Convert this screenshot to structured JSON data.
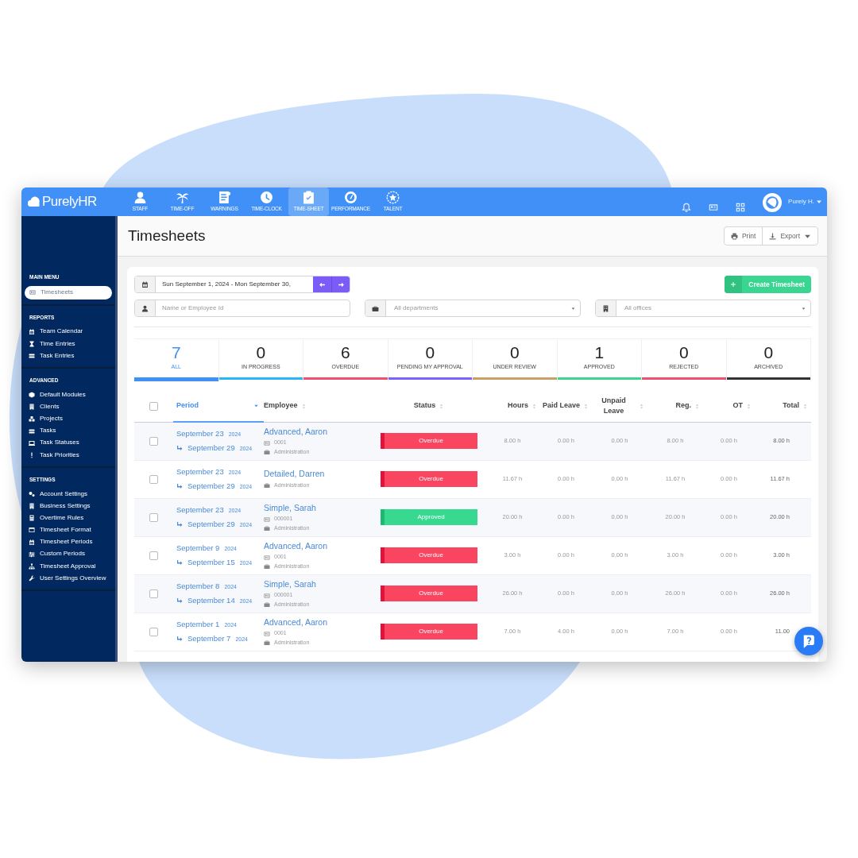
{
  "topbar": {
    "logo": "PurelyHR",
    "modules": [
      {
        "label": "STAFF",
        "selected": false
      },
      {
        "label": "TIME-OFF",
        "selected": false
      },
      {
        "label": "WARNINGS",
        "selected": false
      },
      {
        "label": "TIME-CLOCK",
        "selected": false
      },
      {
        "label": "TIME-SHEET",
        "selected": true
      },
      {
        "label": "PERFORMANCE",
        "selected": false
      },
      {
        "label": "TALENT",
        "selected": false
      }
    ],
    "user": "Purely H."
  },
  "sidebar": {
    "sections": [
      {
        "title": "MAIN MENU",
        "items": [
          {
            "label": "Timesheets",
            "selected": true
          }
        ]
      },
      {
        "title": "REPORTS",
        "items": [
          {
            "label": "Team Calendar",
            "selected": false
          },
          {
            "label": "Time Entries",
            "selected": false
          },
          {
            "label": "Task Entries",
            "selected": false
          }
        ]
      },
      {
        "title": "ADVANCED",
        "items": [
          {
            "label": "Default Modules",
            "selected": false
          },
          {
            "label": "Clients",
            "selected": false
          },
          {
            "label": "Projects",
            "selected": false
          },
          {
            "label": "Tasks",
            "selected": false
          },
          {
            "label": "Task Statuses",
            "selected": false
          },
          {
            "label": "Task Priorities",
            "selected": false
          }
        ]
      },
      {
        "title": "SETTINGS",
        "items": [
          {
            "label": "Account Settings",
            "selected": false
          },
          {
            "label": "Business Settings",
            "selected": false
          },
          {
            "label": "Overtime Rules",
            "selected": false
          },
          {
            "label": "Timesheet Format",
            "selected": false
          },
          {
            "label": "Timesheet Periods",
            "selected": false
          },
          {
            "label": "Custom Periods",
            "selected": false
          },
          {
            "label": "Timesheet Approval",
            "selected": false
          },
          {
            "label": "User Settings Overview",
            "selected": false
          }
        ]
      }
    ]
  },
  "page": {
    "title": "Timesheets",
    "actions": [
      "Print",
      "Export"
    ]
  },
  "filters": {
    "date_range": "Sun September 1, 2024 - Mon September 30,",
    "create_button": "Create Timesheet",
    "employee": {
      "placeholder": "Name or Employee Id"
    },
    "department": {
      "placeholder": "All departments"
    },
    "office": {
      "placeholder": "All offices"
    }
  },
  "status_tabs": [
    {
      "count": "7",
      "label": "ALL",
      "selected": true,
      "color": "#4190f7"
    },
    {
      "count": "0",
      "label": "IN PROGRESS",
      "selected": false,
      "color": "#29b6f6"
    },
    {
      "count": "6",
      "label": "OVERDUE",
      "selected": false,
      "color": "#f0506e"
    },
    {
      "count": "0",
      "label": "PENDING MY APPROVAL",
      "selected": false,
      "color": "#7b61ff"
    },
    {
      "count": "0",
      "label": "UNDER REVIEW",
      "selected": false,
      "color": "#c9a063"
    },
    {
      "count": "1",
      "label": "APPROVED",
      "selected": false,
      "color": "#3ad68f"
    },
    {
      "count": "0",
      "label": "REJECTED",
      "selected": false,
      "color": "#f0506e"
    },
    {
      "count": "0",
      "label": "ARCHIVED",
      "selected": false,
      "color": "#333333"
    }
  ],
  "table": {
    "select_all_checked": false,
    "columns": [
      {
        "label": "Period",
        "sorted": true
      },
      {
        "label": "Employee",
        "sorted": false
      },
      {
        "label": "Status",
        "sorted": false
      },
      {
        "label": "Hours",
        "sorted": false
      },
      {
        "label": "Paid Leave",
        "sorted": false
      },
      {
        "label": "Unpaid Leave",
        "sorted": false
      },
      {
        "label": "Reg.",
        "sorted": false
      },
      {
        "label": "OT",
        "sorted": false
      },
      {
        "label": "Total",
        "sorted": false
      }
    ],
    "rows": [
      {
        "checked": false,
        "start": "September 23",
        "start_year": "2024",
        "end": "September 29",
        "end_year": "2024",
        "employee": "Advanced, Aaron",
        "employee_id": "0001",
        "department": "Administration",
        "status": {
          "kind": "overdue",
          "label": "Overdue"
        },
        "values": [
          "8.00 h",
          "0.00 h",
          "0.00 h",
          "8.00 h",
          "0.00 h",
          "8.00 h"
        ]
      },
      {
        "checked": false,
        "start": "September 23",
        "start_year": "2024",
        "end": "September 29",
        "end_year": "2024",
        "employee": "Detailed, Darren",
        "department": "Administration",
        "status": {
          "kind": "overdue",
          "label": "Overdue"
        },
        "values": [
          "11.67 h",
          "0.00 h",
          "0.00 h",
          "11.67 h",
          "0.00 h",
          "11.67 h"
        ]
      },
      {
        "checked": false,
        "start": "September 23",
        "start_year": "2024",
        "end": "September 29",
        "end_year": "2024",
        "employee": "Simple, Sarah",
        "employee_id": "000001",
        "department": "Administration",
        "status": {
          "kind": "approved",
          "label": "Approved"
        },
        "values": [
          "20.00 h",
          "0.00 h",
          "0.00 h",
          "20.00 h",
          "0.00 h",
          "20.00 h"
        ]
      },
      {
        "checked": false,
        "start": "September 9",
        "start_year": "2024",
        "end": "September 15",
        "end_year": "2024",
        "employee": "Advanced, Aaron",
        "employee_id": "0001",
        "department": "Administration",
        "status": {
          "kind": "overdue",
          "label": "Overdue"
        },
        "values": [
          "3.00 h",
          "0.00 h",
          "0.00 h",
          "3.00 h",
          "0.00 h",
          "3.00 h"
        ]
      },
      {
        "checked": false,
        "start": "September 8",
        "start_year": "2024",
        "end": "September 14",
        "end_year": "2024",
        "employee": "Simple, Sarah",
        "employee_id": "000001",
        "department": "Administration",
        "status": {
          "kind": "overdue",
          "label": "Overdue"
        },
        "values": [
          "26.00 h",
          "0.00 h",
          "0.00 h",
          "26.00 h",
          "0.00 h",
          "26.00 h"
        ]
      },
      {
        "checked": false,
        "start": "September 1",
        "start_year": "2024",
        "end": "September 7",
        "end_year": "2024",
        "employee": "Advanced, Aaron",
        "employee_id": "0001",
        "department": "Administration",
        "status": {
          "kind": "overdue",
          "label": "Overdue"
        },
        "values": [
          "7.00 h",
          "4.00 h",
          "0.00 h",
          "7.00 h",
          "0.00 h",
          "11.00"
        ]
      }
    ]
  }
}
